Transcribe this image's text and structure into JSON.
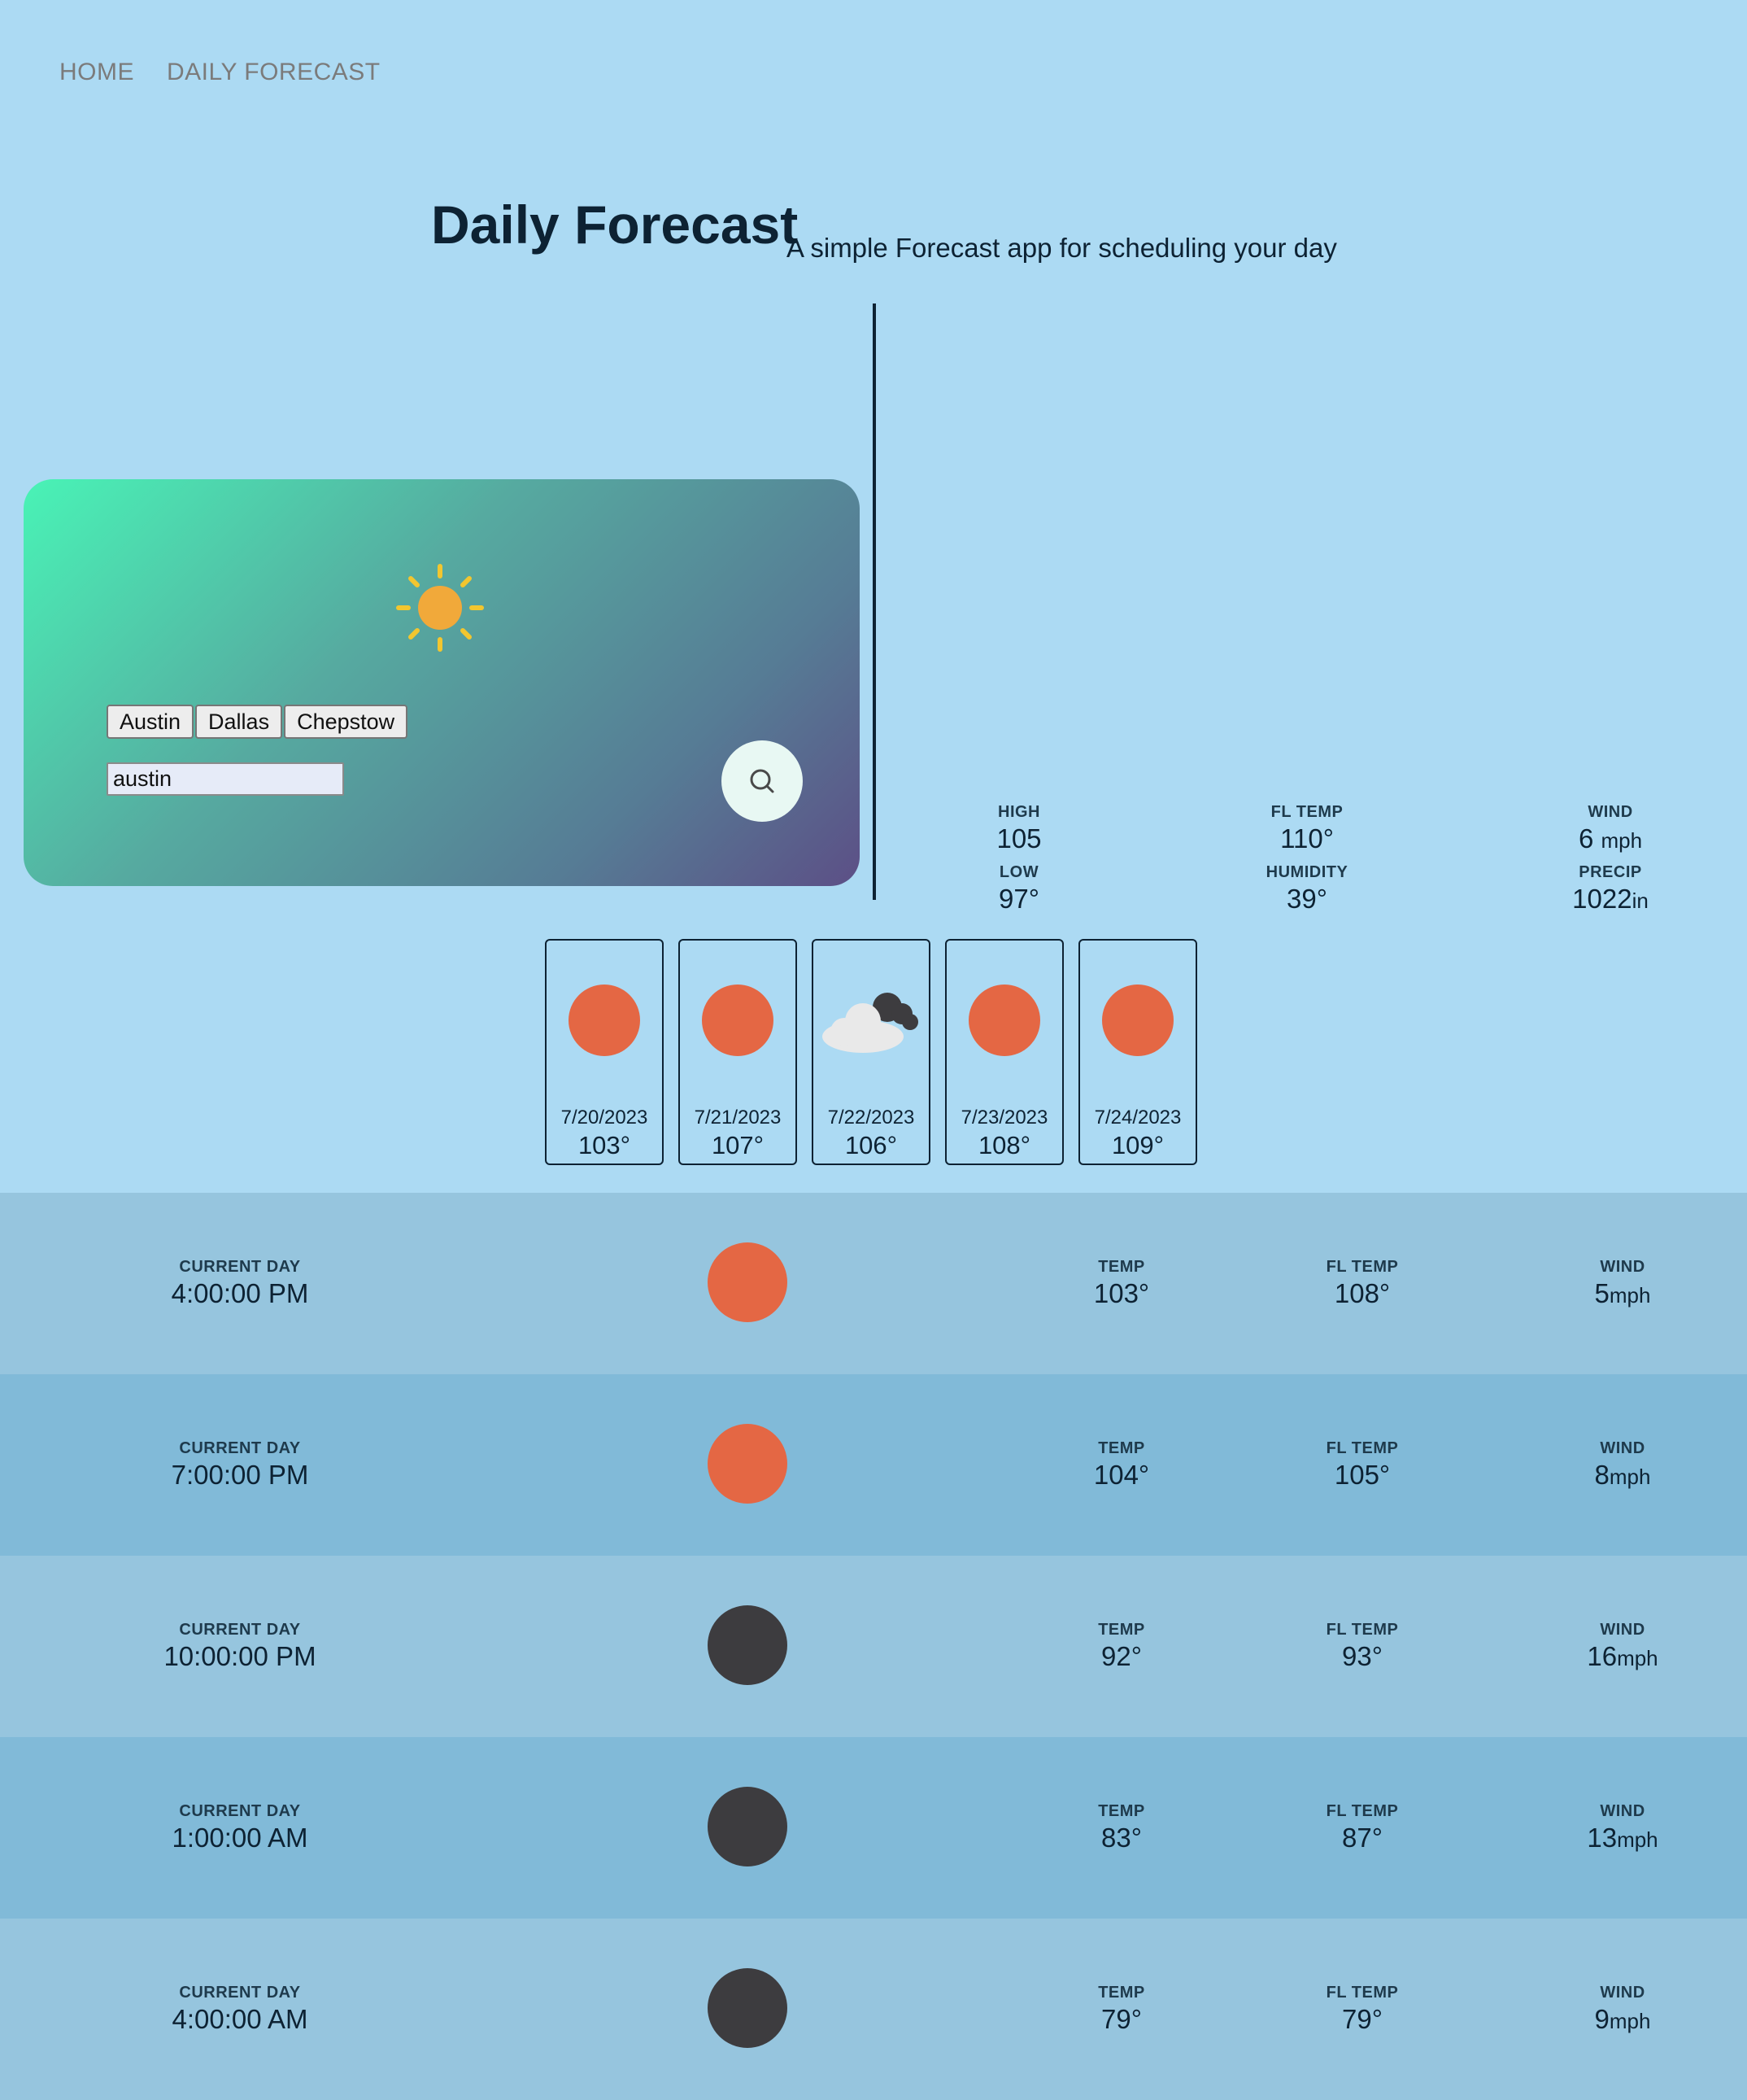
{
  "nav": {
    "home": "HOME",
    "daily": "DAILY FORECAST"
  },
  "header": {
    "title": "Daily Forecast",
    "subtitle": "A simple Forecast app for scheduling your day"
  },
  "search": {
    "cities": [
      "Austin",
      "Dallas",
      "Chepstow"
    ],
    "value": "austin"
  },
  "current": {
    "high_label": "HIGH",
    "high": "105",
    "low_label": "LOW",
    "low": "97°",
    "fl_label": "FL TEMP",
    "fl": "110°",
    "humidity_label": "HUMIDITY",
    "humidity": "39°",
    "wind_label": "WIND",
    "wind": "6",
    "wind_unit": "mph",
    "precip_label": "PRECIP",
    "precip": "1022",
    "precip_unit": "in"
  },
  "daily": [
    {
      "date": "7/20/2023",
      "temp": "103°",
      "icon": "sun-icon"
    },
    {
      "date": "7/21/2023",
      "temp": "107°",
      "icon": "sun-icon"
    },
    {
      "date": "7/22/2023",
      "temp": "106°",
      "icon": "cloud-icon"
    },
    {
      "date": "7/23/2023",
      "temp": "108°",
      "icon": "sun-icon"
    },
    {
      "date": "7/24/2023",
      "temp": "109°",
      "icon": "sun-icon"
    }
  ],
  "hourly_labels": {
    "day": "CURRENT DAY",
    "temp": "TEMP",
    "fl": "FL TEMP",
    "wind": "WIND",
    "wind_unit": "mph"
  },
  "hourly": [
    {
      "time": "4:00:00 PM",
      "temp": "103°",
      "fl": "108°",
      "wind": "5",
      "icon": "sun-icon"
    },
    {
      "time": "7:00:00 PM",
      "temp": "104°",
      "fl": "105°",
      "wind": "8",
      "icon": "sun-icon"
    },
    {
      "time": "10:00:00 PM",
      "temp": "92°",
      "fl": "93°",
      "wind": "16",
      "icon": "moon-icon"
    },
    {
      "time": "1:00:00 AM",
      "temp": "83°",
      "fl": "87°",
      "wind": "13",
      "icon": "moon-icon"
    },
    {
      "time": "4:00:00 AM",
      "temp": "79°",
      "fl": "79°",
      "wind": "9",
      "icon": "moon-icon"
    }
  ],
  "colors": {
    "accent": "#e46744",
    "night": "#3d3c3f",
    "background": "#acdaf3"
  }
}
